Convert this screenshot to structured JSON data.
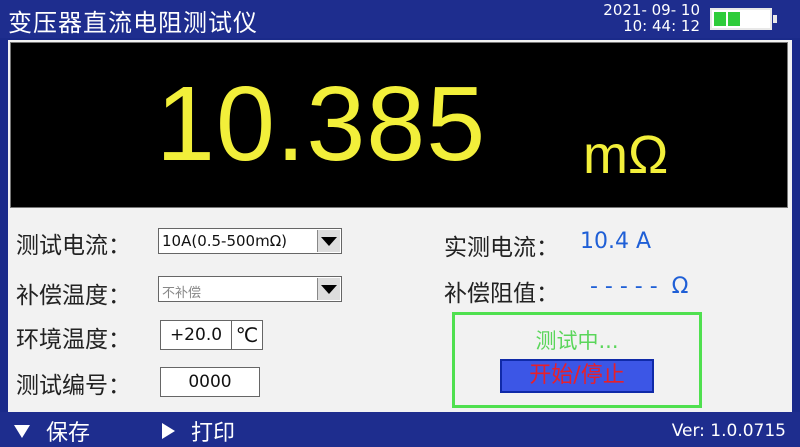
{
  "header": {
    "title": "变压器直流电阻测试仪",
    "date": "2021- 09- 10",
    "time": "10: 44: 12",
    "battery_icon": "battery-icon",
    "battery_level": 0.5
  },
  "display": {
    "reading": "10.385",
    "unit": "mΩ",
    "reading_color": "#f2ef3a"
  },
  "settings": {
    "test_current_label": "测试电流：",
    "test_current_value": "10A(0.5-500mΩ)",
    "compensation_label": "补偿温度：",
    "compensation_value": "不补偿",
    "ambient_label": "环境温度：",
    "ambient_value": "+20.0",
    "ambient_unit": "℃",
    "test_number_label": "测试编号：",
    "test_number_value": "0000"
  },
  "measurements": {
    "actual_current_label": "实测电流：",
    "actual_current_value": "10.4 A",
    "compensated_label": "补偿阻值：",
    "compensated_value": "- - - - -  Ω"
  },
  "status": {
    "text": "测试中...",
    "button_label": "开始/停止"
  },
  "footer": {
    "save_label": "保存",
    "print_label": "打印",
    "version": "Ver: 1.0.0715",
    "save_icon": "triangle-down-icon",
    "print_icon": "triangle-right-icon"
  }
}
